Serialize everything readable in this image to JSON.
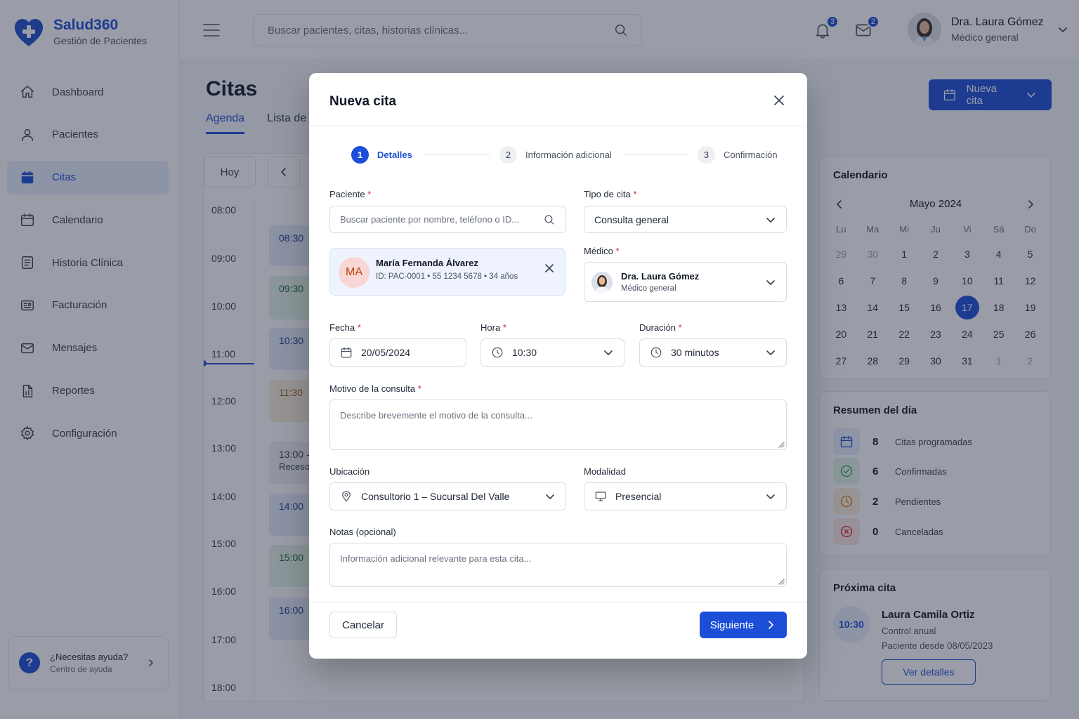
{
  "brand": {
    "name": "Salud360",
    "subtitle": "Gestión de Pacientes"
  },
  "sidebar": {
    "items": [
      {
        "label": "Dashboard",
        "icon": "home-icon"
      },
      {
        "label": "Pacientes",
        "icon": "user-icon"
      },
      {
        "label": "Citas",
        "icon": "calendar-filled-icon",
        "active": true
      },
      {
        "label": "Calendario",
        "icon": "calendar-icon"
      },
      {
        "label": "Historia Clínica",
        "icon": "document-icon"
      },
      {
        "label": "Facturación",
        "icon": "invoice-icon"
      },
      {
        "label": "Mensajes",
        "icon": "mail-icon"
      },
      {
        "label": "Reportes",
        "icon": "report-icon"
      },
      {
        "label": "Configuración",
        "icon": "gear-icon"
      }
    ],
    "help": {
      "title": "¿Necesitas ayuda?",
      "subtitle": "Centro de ayuda",
      "icon_text": "?"
    }
  },
  "header": {
    "search_placeholder": "Buscar pacientes, citas, historias clínicas...",
    "notifications_count": "3",
    "messages_count": "2",
    "user": {
      "name": "Dra. Laura Gómez",
      "role": "Médico general"
    }
  },
  "main": {
    "title": "Citas",
    "tabs": [
      "Agenda",
      "Lista de"
    ],
    "new_button": "Nueva cita",
    "today_button": "Hoy",
    "times": [
      "08:00",
      "09:00",
      "10:00",
      "11:00",
      "12:00",
      "13:00",
      "14:00",
      "15:00",
      "16:00",
      "17:00",
      "18:00"
    ],
    "events": [
      {
        "time": "08:30",
        "color": "blue"
      },
      {
        "time": "09:30",
        "color": "green"
      },
      {
        "time": "10:30",
        "color": "blue"
      },
      {
        "time": "11:30",
        "color": "orange"
      },
      {
        "time": "13:00 -",
        "sub": "Receso",
        "color": "gray"
      },
      {
        "time": "14:00",
        "color": "blue"
      },
      {
        "time": "15:00",
        "color": "green"
      },
      {
        "time": "16:00",
        "color": "blue"
      }
    ]
  },
  "calendar": {
    "title": "Calendario",
    "month": "Mayo 2024",
    "weekdays": [
      "Lu",
      "Ma",
      "Mi",
      "Ju",
      "Vi",
      "Sá",
      "Do"
    ],
    "days": [
      {
        "d": "29",
        "muted": true
      },
      {
        "d": "30",
        "muted": true
      },
      {
        "d": "1"
      },
      {
        "d": "2"
      },
      {
        "d": "3"
      },
      {
        "d": "4"
      },
      {
        "d": "5"
      },
      {
        "d": "6"
      },
      {
        "d": "7"
      },
      {
        "d": "8"
      },
      {
        "d": "9"
      },
      {
        "d": "10"
      },
      {
        "d": "11"
      },
      {
        "d": "12"
      },
      {
        "d": "13"
      },
      {
        "d": "14"
      },
      {
        "d": "15"
      },
      {
        "d": "16"
      },
      {
        "d": "17",
        "selected": true
      },
      {
        "d": "18"
      },
      {
        "d": "19"
      },
      {
        "d": "20"
      },
      {
        "d": "21"
      },
      {
        "d": "22"
      },
      {
        "d": "23"
      },
      {
        "d": "24"
      },
      {
        "d": "25"
      },
      {
        "d": "26"
      },
      {
        "d": "27"
      },
      {
        "d": "28"
      },
      {
        "d": "29"
      },
      {
        "d": "30"
      },
      {
        "d": "31"
      },
      {
        "d": "1",
        "muted": true
      },
      {
        "d": "2",
        "muted": true
      }
    ]
  },
  "summary": {
    "title": "Resumen del día",
    "rows": [
      {
        "n": "8",
        "label": "Citas programadas",
        "icon": "calendar-icon",
        "color": "#1d4ed8",
        "bg": "#e8eefc"
      },
      {
        "n": "6",
        "label": "Confirmadas",
        "icon": "check-circle-icon",
        "color": "#16a34a",
        "bg": "#e4f4e8"
      },
      {
        "n": "2",
        "label": "Pendientes",
        "icon": "clock-icon",
        "color": "#d97706",
        "bg": "#fbeedd"
      },
      {
        "n": "0",
        "label": "Canceladas",
        "icon": "x-circle-icon",
        "color": "#dc2626",
        "bg": "#fde6e6"
      }
    ]
  },
  "next": {
    "title": "Próxima cita",
    "time": "10:30",
    "name": "Laura Camila Ortiz",
    "type": "Control anual",
    "since": "Paciente desde 08/05/2023",
    "button": "Ver detalles"
  },
  "modal": {
    "title": "Nueva cita",
    "steps": [
      {
        "n": "1",
        "label": "Detalles",
        "active": true
      },
      {
        "n": "2",
        "label": "Información adicional"
      },
      {
        "n": "3",
        "label": "Confirmación"
      }
    ],
    "patient": {
      "label": "Paciente",
      "placeholder": "Buscar paciente por nombre, teléfono o ID...",
      "selected": {
        "initials": "MA",
        "name": "María Fernanda Álvarez",
        "meta": "ID: PAC-0001  •  55 1234 5678  •  34 años"
      }
    },
    "type": {
      "label": "Tipo de cita",
      "value": "Consulta general"
    },
    "doctor": {
      "label": "Médico",
      "name": "Dra. Laura Gómez",
      "role": "Médico general"
    },
    "date": {
      "label": "Fecha",
      "value": "20/05/2024"
    },
    "hour": {
      "label": "Hora",
      "value": "10:30"
    },
    "duration": {
      "label": "Duración",
      "value": "30 minutos"
    },
    "reason": {
      "label": "Motivo de la consulta",
      "placeholder": "Describe brevemente el motivo de la consulta..."
    },
    "location": {
      "label": "Ubicación",
      "value": "Consultorio 1 – Sucursal Del Valle"
    },
    "modality": {
      "label": "Modalidad",
      "value": "Presencial"
    },
    "notes": {
      "label": "Notas (opcional)",
      "placeholder": "Información adicional relevante para esta cita..."
    },
    "required_mark": "*",
    "cancel": "Cancelar",
    "next": "Siguiente"
  }
}
